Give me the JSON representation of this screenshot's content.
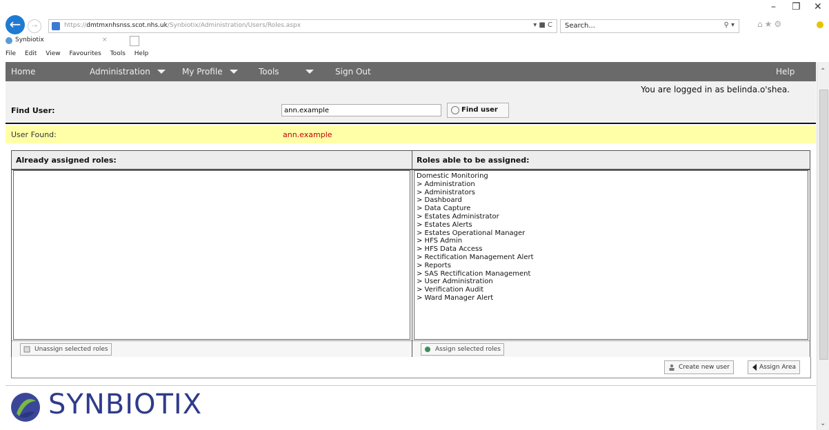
{
  "browser": {
    "url_prefix": "https://",
    "url_host": "dmtmxnhsnss.scot.nhs.uk",
    "url_path": "/Synbiotix/Administration/Users/Roles.aspx",
    "search_placeholder": "Search...",
    "tab_title": "Synbiotix",
    "menu": [
      "File",
      "Edit",
      "View",
      "Favourites",
      "Tools",
      "Help"
    ]
  },
  "nav": {
    "home": "Home",
    "administration": "Administration",
    "my_profile": "My Profile",
    "tools": "Tools",
    "sign_out": "Sign Out",
    "help": "Help"
  },
  "logged_in_text": "You are logged in as belinda.o'shea.",
  "find_user": {
    "label": "Find User:",
    "value": "ann.example",
    "button": "Find user"
  },
  "user_found": {
    "label": "User Found:",
    "value": "ann.example"
  },
  "assigned": {
    "title": "Already assigned roles:",
    "button": "Unassign selected roles"
  },
  "assignable": {
    "title": "Roles able to be assigned:",
    "button": "Assign selected roles",
    "roles": [
      "Domestic Monitoring",
      "> Administration",
      "> Administrators",
      "> Dashboard",
      "> Data Capture",
      "> Estates Administrator",
      "> Estates Alerts",
      "> Estates Operational Manager",
      "> HFS Admin",
      "> HFS Data Access",
      "> Rectification Management Alert",
      "> Reports",
      "> SAS Rectification Management",
      "> User Administration",
      "> Verification Audit",
      "> Ward Manager Alert"
    ]
  },
  "actions": {
    "create_user": "Create new user",
    "assign_area": "Assign Area"
  },
  "logo_text": "SYNBIOTIX",
  "colors": {
    "nav_bg": "#6a6a6a",
    "found_bg": "#ffffa8",
    "found_value": "#c00000",
    "logo": "#2f3b8a"
  }
}
